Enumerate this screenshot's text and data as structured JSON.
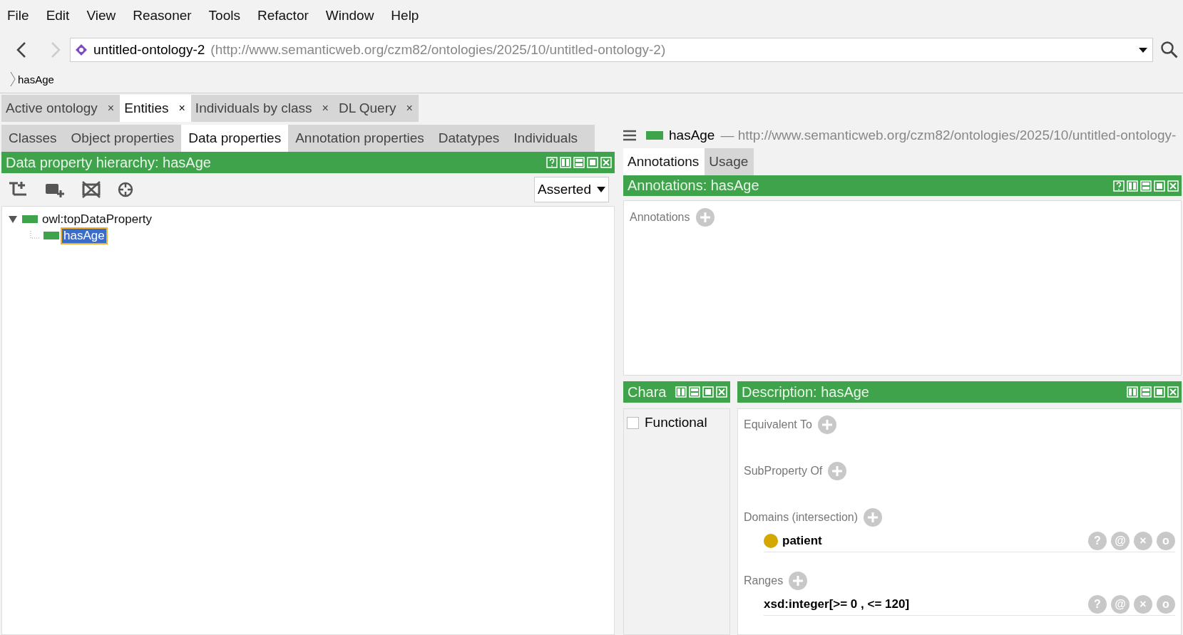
{
  "menu": [
    "File",
    "Edit",
    "View",
    "Reasoner",
    "Tools",
    "Refactor",
    "Window",
    "Help"
  ],
  "address": {
    "name": "untitled-ontology-2",
    "iri": "(http://www.semanticweb.org/czm82/ontologies/2025/10/untitled-ontology-2)"
  },
  "breadcrumb": "hasAge",
  "tabs": [
    {
      "label": "Active ontology",
      "selected": false,
      "close": "×"
    },
    {
      "label": "Entities",
      "selected": true,
      "close": "×"
    },
    {
      "label": "Individuals by class",
      "selected": false,
      "close": "×"
    },
    {
      "label": "DL Query",
      "selected": false,
      "close": "×"
    }
  ],
  "entity_tabs": [
    {
      "label": "Classes",
      "selected": false
    },
    {
      "label": "Object properties",
      "selected": false
    },
    {
      "label": "Data properties",
      "selected": true
    },
    {
      "label": "Annotation properties",
      "selected": false
    },
    {
      "label": "Datatypes",
      "selected": false
    },
    {
      "label": "Individuals",
      "selected": false
    }
  ],
  "hierarchy": {
    "title": "Data property hierarchy: hasAge",
    "mode": "Asserted",
    "tree": [
      {
        "label": "owl:topDataProperty",
        "expanded": true,
        "selected": false,
        "children": [
          {
            "label": "hasAge",
            "selected": true
          }
        ]
      }
    ]
  },
  "entity_header": {
    "name": "hasAge",
    "dash": "—",
    "iri": "http://www.semanticweb.org/czm82/ontologies/2025/10/untitled-ontology-"
  },
  "detail_tabs": [
    {
      "label": "Annotations",
      "selected": true
    },
    {
      "label": "Usage",
      "selected": false
    }
  ],
  "annotations": {
    "title": "Annotations: hasAge",
    "label": "Annotations"
  },
  "characteristics": {
    "title": "Chara",
    "items": [
      {
        "label": "Functional",
        "checked": false
      }
    ]
  },
  "description": {
    "title": "Description: hasAge",
    "sections": [
      {
        "label": "Equivalent To"
      },
      {
        "label": "SubProperty Of"
      },
      {
        "label": "Domains (intersection)",
        "items": [
          {
            "kind": "class",
            "text": "patient",
            "color": "#d4a800",
            "actions": [
              "?",
              "@",
              "×",
              "o"
            ]
          }
        ]
      },
      {
        "label": "Ranges",
        "items": [
          {
            "kind": "datatype",
            "text": "xsd:integer[>= 0 , <= 120]",
            "actions": [
              "?",
              "@",
              "×",
              "o"
            ]
          }
        ]
      }
    ]
  }
}
